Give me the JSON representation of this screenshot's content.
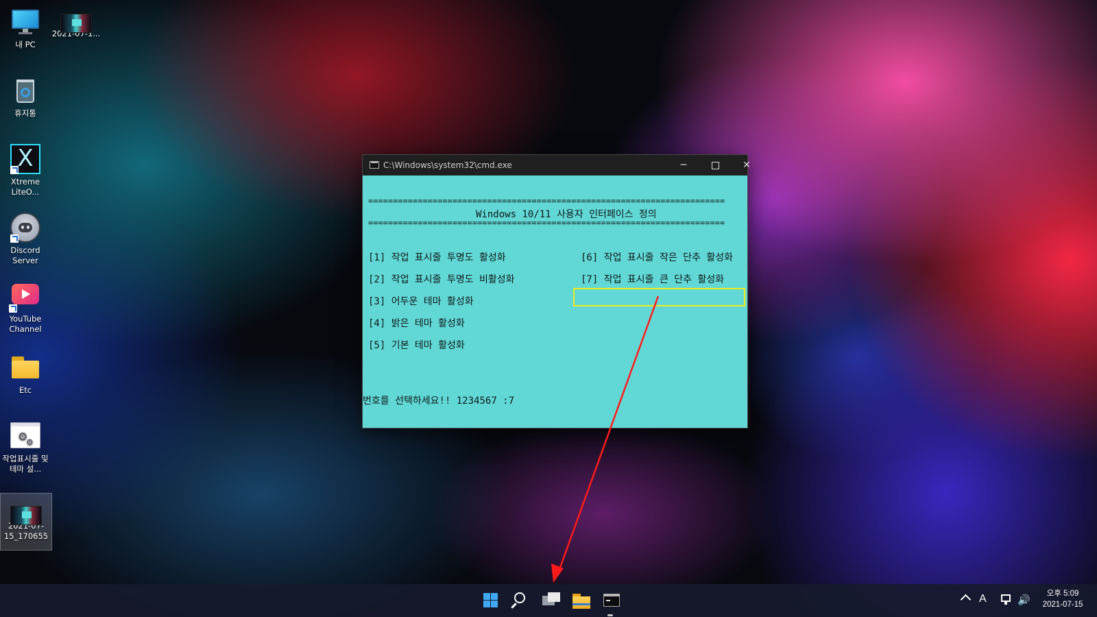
{
  "desktop": {
    "icons": [
      {
        "label": "내 PC",
        "icon": "computer-icon"
      },
      {
        "label": "2021-07-1...",
        "icon": "image-thumbnail-icon"
      },
      {
        "label": "휴지통",
        "icon": "recycle-bin-icon"
      },
      {
        "label": "Xtreme LiteO...",
        "icon": "xtreme-lite-icon"
      },
      {
        "label": "Discord Server",
        "icon": "discord-icon"
      },
      {
        "label": "YouTube Channel",
        "icon": "youtube-icon"
      },
      {
        "label": "Etc",
        "icon": "folder-icon"
      },
      {
        "label": "작업표시줄 및 테마 설...",
        "icon": "settings-script-icon"
      },
      {
        "label": "2021-07-15_170655",
        "icon": "image-thumbnail-icon"
      }
    ],
    "x_glyph": "X"
  },
  "cmd_window": {
    "title": "C:\\Windows\\system32\\cmd.exe",
    "controls": {
      "minimize": "─",
      "close": "✕"
    },
    "separator": "========================================================================",
    "header": "Windows 10/11 사용자 인터페이스 정의",
    "options_left": [
      "[1] 작업 표시줄 투명도 활성화",
      "[2] 작업 표시줄 투명도 비활성화",
      "[3] 어두운 테마 활성화",
      "[4] 밝은 테마 활성화",
      "[5] 기본 테마 활성화"
    ],
    "options_right": [
      "[6] 작업 표시줄 작은 단추 활성화",
      "[7] 작업 표시줄 큰 단추 활성화"
    ],
    "prompt": "번호를 선택하세요!! 1234567 :7",
    "highlighted_option": "[7] 작업 표시줄 큰 단추 활성화"
  },
  "annotation": {
    "arrow_color": "#ff1a1a",
    "box_color": "#f0ea1a"
  },
  "taskbar": {
    "items": [
      "start",
      "search",
      "task-view",
      "file-explorer",
      "command-prompt"
    ],
    "ime_indicator": "A",
    "volume_glyph": "🔊",
    "clock_time": "오후 5:09",
    "clock_date": "2021-07-15"
  },
  "colors": {
    "console_bg": "#62d8d6",
    "titlebar_bg": "#1f1f1f",
    "taskbar_bg": "#161a2c"
  }
}
